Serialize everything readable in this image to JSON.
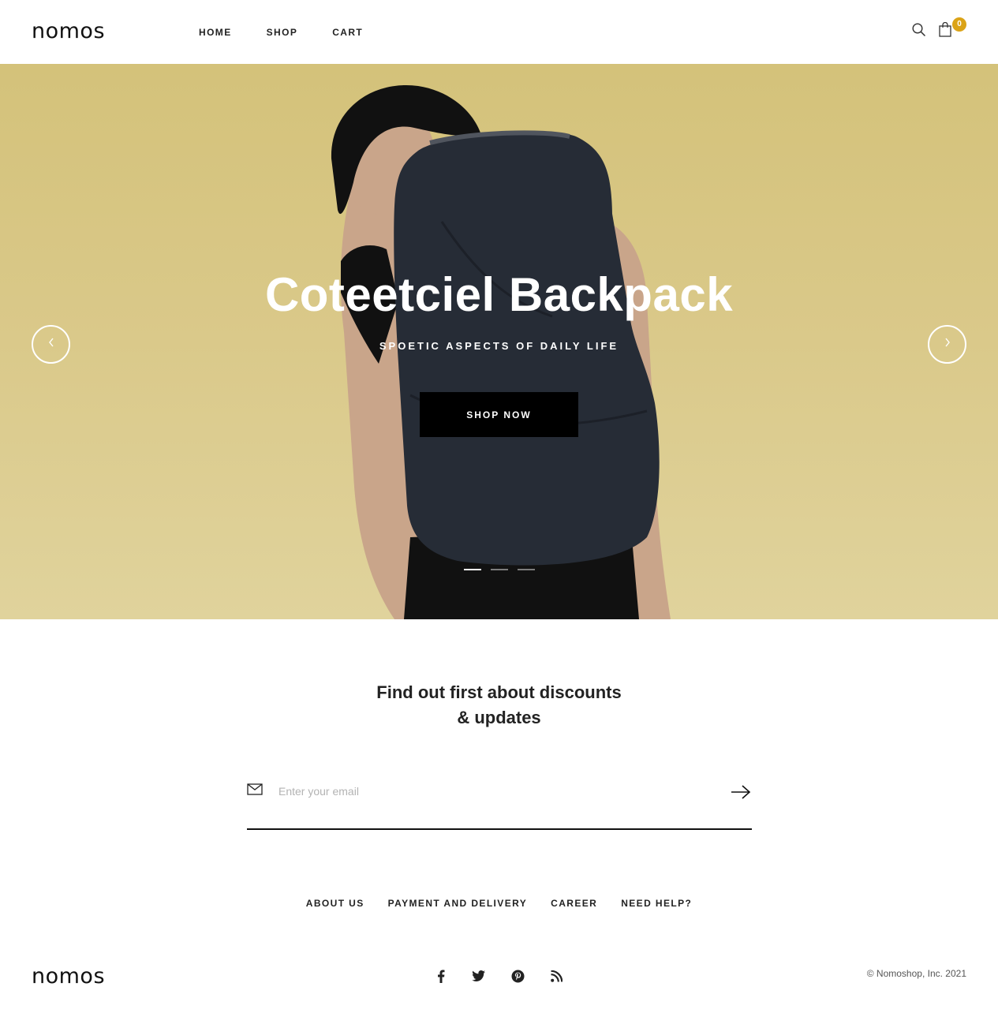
{
  "brand": {
    "logo_text": "nomos"
  },
  "nav": {
    "items": [
      "HOME",
      "SHOP",
      "CART"
    ]
  },
  "header": {
    "icons": [
      "search-icon",
      "shopping-bag-icon"
    ],
    "cart_count": "0",
    "badge_color": "#dba317"
  },
  "hero": {
    "title": "Coteetciel Backpack",
    "subtitle": "SPOETIC ASPECTS OF DAILY LIFE",
    "cta_label": "SHOP NOW",
    "background_color": "#d8c885",
    "slides_total": 3,
    "active_slide": 1,
    "icons": [
      "chevron-left-icon",
      "chevron-right-icon"
    ]
  },
  "newsletter": {
    "title_line1": "Find out first about discounts",
    "title_line2": "& updates",
    "placeholder": "Enter your email",
    "icons": [
      "mail-icon",
      "arrow-right-icon"
    ]
  },
  "footer": {
    "links": [
      "ABOUT US",
      "PAYMENT AND DELIVERY",
      "CAREER",
      "NEED HELP?"
    ],
    "logo_text": "nomos",
    "social_icons": [
      "facebook-icon",
      "twitter-icon",
      "pinterest-icon",
      "rss-icon"
    ],
    "copyright": "© Nomoshop, Inc. 2021"
  }
}
